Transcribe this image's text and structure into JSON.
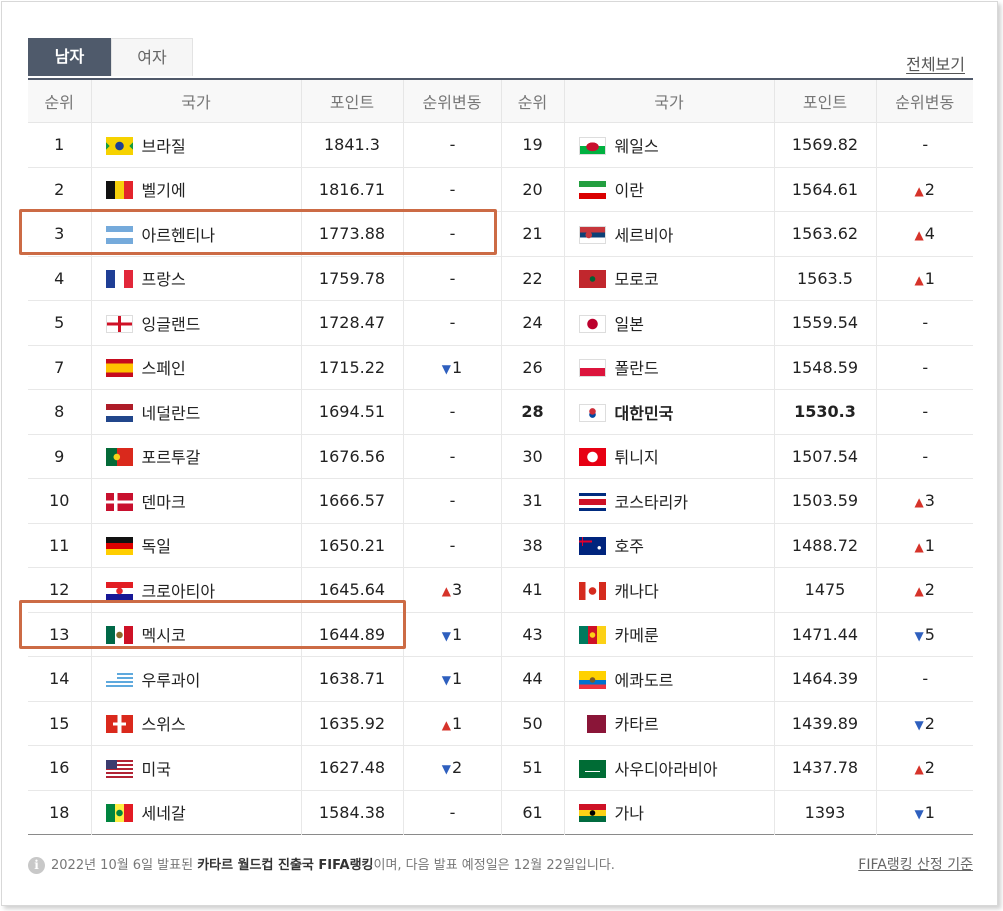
{
  "tabs": {
    "men": "남자",
    "women": "여자"
  },
  "view_all": "전체보기",
  "headers": {
    "rank": "순위",
    "country": "국가",
    "points": "포인트",
    "change": "순위변동"
  },
  "left": [
    {
      "rank": "1",
      "country": "브라질",
      "points": "1841.3",
      "dir": "",
      "num": "-",
      "flag": "brazil"
    },
    {
      "rank": "2",
      "country": "벨기에",
      "points": "1816.71",
      "dir": "",
      "num": "-",
      "flag": "belgium"
    },
    {
      "rank": "3",
      "country": "아르헨티나",
      "points": "1773.88",
      "dir": "",
      "num": "-",
      "flag": "argentina"
    },
    {
      "rank": "4",
      "country": "프랑스",
      "points": "1759.78",
      "dir": "",
      "num": "-",
      "flag": "france"
    },
    {
      "rank": "5",
      "country": "잉글랜드",
      "points": "1728.47",
      "dir": "",
      "num": "-",
      "flag": "england"
    },
    {
      "rank": "7",
      "country": "스페인",
      "points": "1715.22",
      "dir": "down",
      "num": "1",
      "flag": "spain"
    },
    {
      "rank": "8",
      "country": "네덜란드",
      "points": "1694.51",
      "dir": "",
      "num": "-",
      "flag": "netherlands"
    },
    {
      "rank": "9",
      "country": "포르투갈",
      "points": "1676.56",
      "dir": "",
      "num": "-",
      "flag": "portugal"
    },
    {
      "rank": "10",
      "country": "덴마크",
      "points": "1666.57",
      "dir": "",
      "num": "-",
      "flag": "denmark"
    },
    {
      "rank": "11",
      "country": "독일",
      "points": "1650.21",
      "dir": "",
      "num": "-",
      "flag": "germany"
    },
    {
      "rank": "12",
      "country": "크로아티아",
      "points": "1645.64",
      "dir": "up",
      "num": "3",
      "flag": "croatia"
    },
    {
      "rank": "13",
      "country": "멕시코",
      "points": "1644.89",
      "dir": "down",
      "num": "1",
      "flag": "mexico"
    },
    {
      "rank": "14",
      "country": "우루과이",
      "points": "1638.71",
      "dir": "down",
      "num": "1",
      "flag": "uruguay"
    },
    {
      "rank": "15",
      "country": "스위스",
      "points": "1635.92",
      "dir": "up",
      "num": "1",
      "flag": "switzerland"
    },
    {
      "rank": "16",
      "country": "미국",
      "points": "1627.48",
      "dir": "down",
      "num": "2",
      "flag": "usa"
    },
    {
      "rank": "18",
      "country": "세네갈",
      "points": "1584.38",
      "dir": "",
      "num": "-",
      "flag": "senegal"
    }
  ],
  "right": [
    {
      "rank": "19",
      "country": "웨일스",
      "points": "1569.82",
      "dir": "",
      "num": "-",
      "flag": "wales"
    },
    {
      "rank": "20",
      "country": "이란",
      "points": "1564.61",
      "dir": "up",
      "num": "2",
      "flag": "iran"
    },
    {
      "rank": "21",
      "country": "세르비아",
      "points": "1563.62",
      "dir": "up",
      "num": "4",
      "flag": "serbia"
    },
    {
      "rank": "22",
      "country": "모로코",
      "points": "1563.5",
      "dir": "up",
      "num": "1",
      "flag": "morocco"
    },
    {
      "rank": "24",
      "country": "일본",
      "points": "1559.54",
      "dir": "",
      "num": "-",
      "flag": "japan"
    },
    {
      "rank": "26",
      "country": "폴란드",
      "points": "1548.59",
      "dir": "",
      "num": "-",
      "flag": "poland"
    },
    {
      "rank": "28",
      "country": "대한민국",
      "points": "1530.3",
      "dir": "",
      "num": "-",
      "flag": "korea",
      "highlight": true
    },
    {
      "rank": "30",
      "country": "튀니지",
      "points": "1507.54",
      "dir": "",
      "num": "-",
      "flag": "tunisia"
    },
    {
      "rank": "31",
      "country": "코스타리카",
      "points": "1503.59",
      "dir": "up",
      "num": "3",
      "flag": "costarica"
    },
    {
      "rank": "38",
      "country": "호주",
      "points": "1488.72",
      "dir": "up",
      "num": "1",
      "flag": "australia"
    },
    {
      "rank": "41",
      "country": "캐나다",
      "points": "1475",
      "dir": "up",
      "num": "2",
      "flag": "canada"
    },
    {
      "rank": "43",
      "country": "카메룬",
      "points": "1471.44",
      "dir": "down",
      "num": "5",
      "flag": "cameroon"
    },
    {
      "rank": "44",
      "country": "에콰도르",
      "points": "1464.39",
      "dir": "",
      "num": "-",
      "flag": "ecuador"
    },
    {
      "rank": "50",
      "country": "카타르",
      "points": "1439.89",
      "dir": "down",
      "num": "2",
      "flag": "qatar"
    },
    {
      "rank": "51",
      "country": "사우디아라비아",
      "points": "1437.78",
      "dir": "up",
      "num": "2",
      "flag": "saudi"
    },
    {
      "rank": "61",
      "country": "가나",
      "points": "1393",
      "dir": "down",
      "num": "1",
      "flag": "ghana"
    }
  ],
  "footer": {
    "info_icon": "info-icon",
    "text_pre": "2022년 10월 6일 발표된 ",
    "text_strong": "카타르 월드컵 진출국 FIFA랭킹",
    "text_post": "이며, 다음 발표 예정일은 12월 22일입니다.",
    "criteria": "FIFA랭킹 산정 기준"
  },
  "colors": {
    "accent": "#4f5a6b",
    "up": "#d6332a",
    "down": "#2e5fbe",
    "highlight_box": "#cc6b45"
  }
}
